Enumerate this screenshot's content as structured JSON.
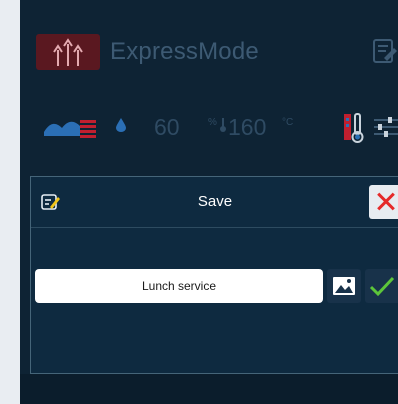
{
  "app": {
    "title": "ExpressMode",
    "logo_icon": "multi-arrow-logo-icon",
    "logo_color": "#5a1820"
  },
  "status_row": {
    "steam_icon": "steam-tray-icon",
    "humidity": {
      "value": "60",
      "unit": "%"
    },
    "temperature": {
      "value": "160",
      "unit": "°C"
    },
    "probe_icon": "core-probe-icon",
    "settings_icon": "sliders-icon"
  },
  "dialog": {
    "title": "Save",
    "name_value": "Lunch service",
    "close_icon": "close-icon",
    "close_color": "#e52a2a",
    "image_icon": "image-icon",
    "confirm_icon": "checkmark-icon",
    "confirm_color": "#5cc53a"
  },
  "colors": {
    "background": "#0e2334",
    "accent_red": "#c01f2f",
    "accent_blue": "#2b6fb5"
  }
}
